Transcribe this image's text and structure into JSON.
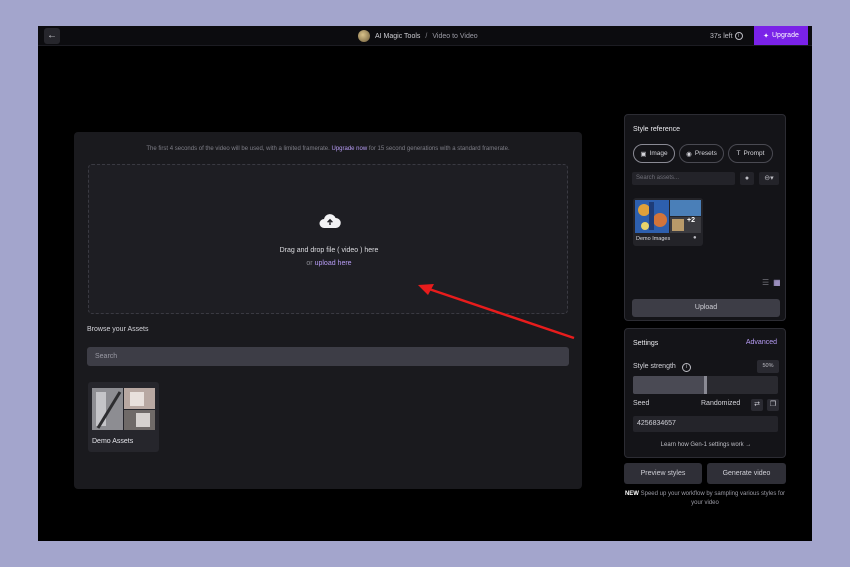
{
  "topbar": {
    "back_icon": "arrow-left-icon",
    "workspace": "AI Magic Tools",
    "separator": "/",
    "page": "Video to Video",
    "credits": "37s left",
    "upgrade_label": "Upgrade",
    "accent_color": "#7a22e8"
  },
  "main": {
    "notice_prefix": "The first 4 seconds of the video will be used, with a limited framerate.",
    "notice_link": "Upgrade now",
    "notice_suffix": "for 15 second generations with a standard framerate.",
    "dropzone_icon": "cloud-upload-icon",
    "dropzone_text": "Drag and drop file ( video ) here",
    "dropzone_or": "or",
    "dropzone_link": "upload here",
    "browse_title": "Browse your Assets",
    "search_placeholder": "Search",
    "asset_folder_label": "Demo Assets"
  },
  "style_reference": {
    "title": "Style reference",
    "tabs": [
      {
        "label": "Image",
        "icon": "image-icon",
        "active": true
      },
      {
        "label": "Presets",
        "icon": "palette-icon",
        "active": false
      },
      {
        "label": "Prompt",
        "icon": "text-icon",
        "active": false
      }
    ],
    "search_placeholder": "Search assets...",
    "demo_images_label": "Demo Images",
    "demo_images_extra": "+2",
    "upload_label": "Upload"
  },
  "settings": {
    "title": "Settings",
    "advanced_label": "Advanced",
    "style_strength_label": "Style strength",
    "style_strength_value": "50%",
    "style_strength_fraction": 0.5,
    "seed_label": "Seed",
    "randomized_label": "Randomized",
    "seed_value": "4256834657",
    "learn_link": "Learn how Gen-1 settings work →"
  },
  "actions": {
    "preview_label": "Preview styles",
    "generate_label": "Generate video",
    "new_badge": "NEW",
    "new_text": "Speed up your workflow by sampling various styles for your video"
  },
  "annotation": {
    "arrow_color": "#e81c1c"
  }
}
